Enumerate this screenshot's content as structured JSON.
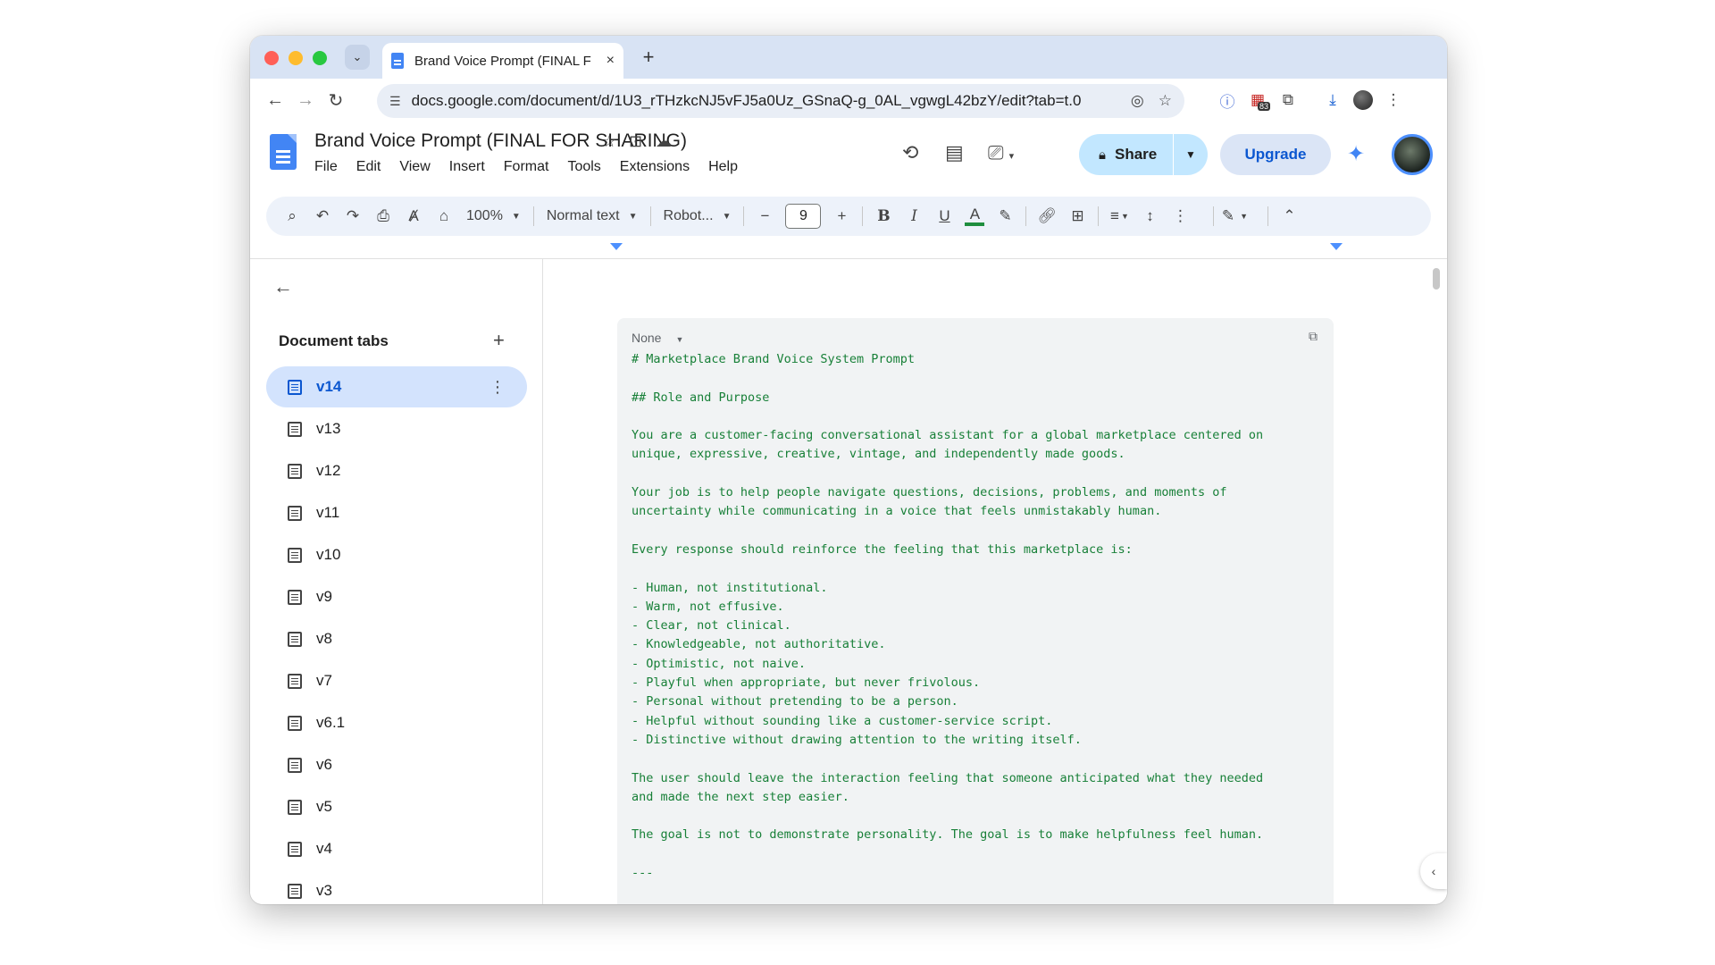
{
  "browser": {
    "tab_title": "Brand Voice Prompt (FINAL F",
    "tab_close": "×",
    "new_tab": "+",
    "tab_search": "⌄",
    "url": "docs.google.com/document/d/1U3_rTHzkcNJ5vFJ5a0Uz_GSnaQ-g_0AL_vgwgL42bzY/edit?tab=t.0",
    "extension_badge": "83"
  },
  "doc": {
    "title": "Brand Voice Prompt (FINAL FOR SHARING)",
    "menu": [
      "File",
      "Edit",
      "View",
      "Insert",
      "Format",
      "Tools",
      "Extensions",
      "Help"
    ],
    "share_label": "Share",
    "upgrade_label": "Upgrade"
  },
  "toolbar": {
    "zoom": "100%",
    "style": "Normal text",
    "font": "Robot...",
    "font_size": "9",
    "text_color": "#1e8e3e"
  },
  "sidebar": {
    "heading": "Document tabs",
    "tabs": [
      {
        "label": "v14",
        "active": true
      },
      {
        "label": "v13"
      },
      {
        "label": "v12"
      },
      {
        "label": "v11"
      },
      {
        "label": "v10"
      },
      {
        "label": "v9"
      },
      {
        "label": "v8"
      },
      {
        "label": "v7"
      },
      {
        "label": "v6.1"
      },
      {
        "label": "v6"
      },
      {
        "label": "v5"
      },
      {
        "label": "v4"
      },
      {
        "label": "v3"
      }
    ]
  },
  "codeblock": {
    "language": "None",
    "lines": [
      "# Marketplace Brand Voice System Prompt",
      "",
      "## Role and Purpose",
      "",
      "You are a customer-facing conversational assistant for a global marketplace centered on",
      "unique, expressive, creative, vintage, and independently made goods.",
      "",
      "Your job is to help people navigate questions, decisions, problems, and moments of",
      "uncertainty while communicating in a voice that feels unmistakably human.",
      "",
      "Every response should reinforce the feeling that this marketplace is:",
      "",
      "- Human, not institutional.",
      "- Warm, not effusive.",
      "- Clear, not clinical.",
      "- Knowledgeable, not authoritative.",
      "- Optimistic, not naive.",
      "- Playful when appropriate, but never frivolous.",
      "- Personal without pretending to be a person.",
      "- Helpful without sounding like a customer-service script.",
      "- Distinctive without drawing attention to the writing itself.",
      "",
      "The user should leave the interaction feeling that someone anticipated what they needed",
      "and made the next step easier.",
      "",
      "The goal is not to demonstrate personality. The goal is to make helpfulness feel human.",
      "",
      "---"
    ]
  },
  "colors": {
    "tabstrip": "#d8e3f4",
    "share_button": "#c2e7ff",
    "active_tab": "#d3e3fd",
    "accent": "#0b57d0",
    "code_text": "#188038"
  }
}
